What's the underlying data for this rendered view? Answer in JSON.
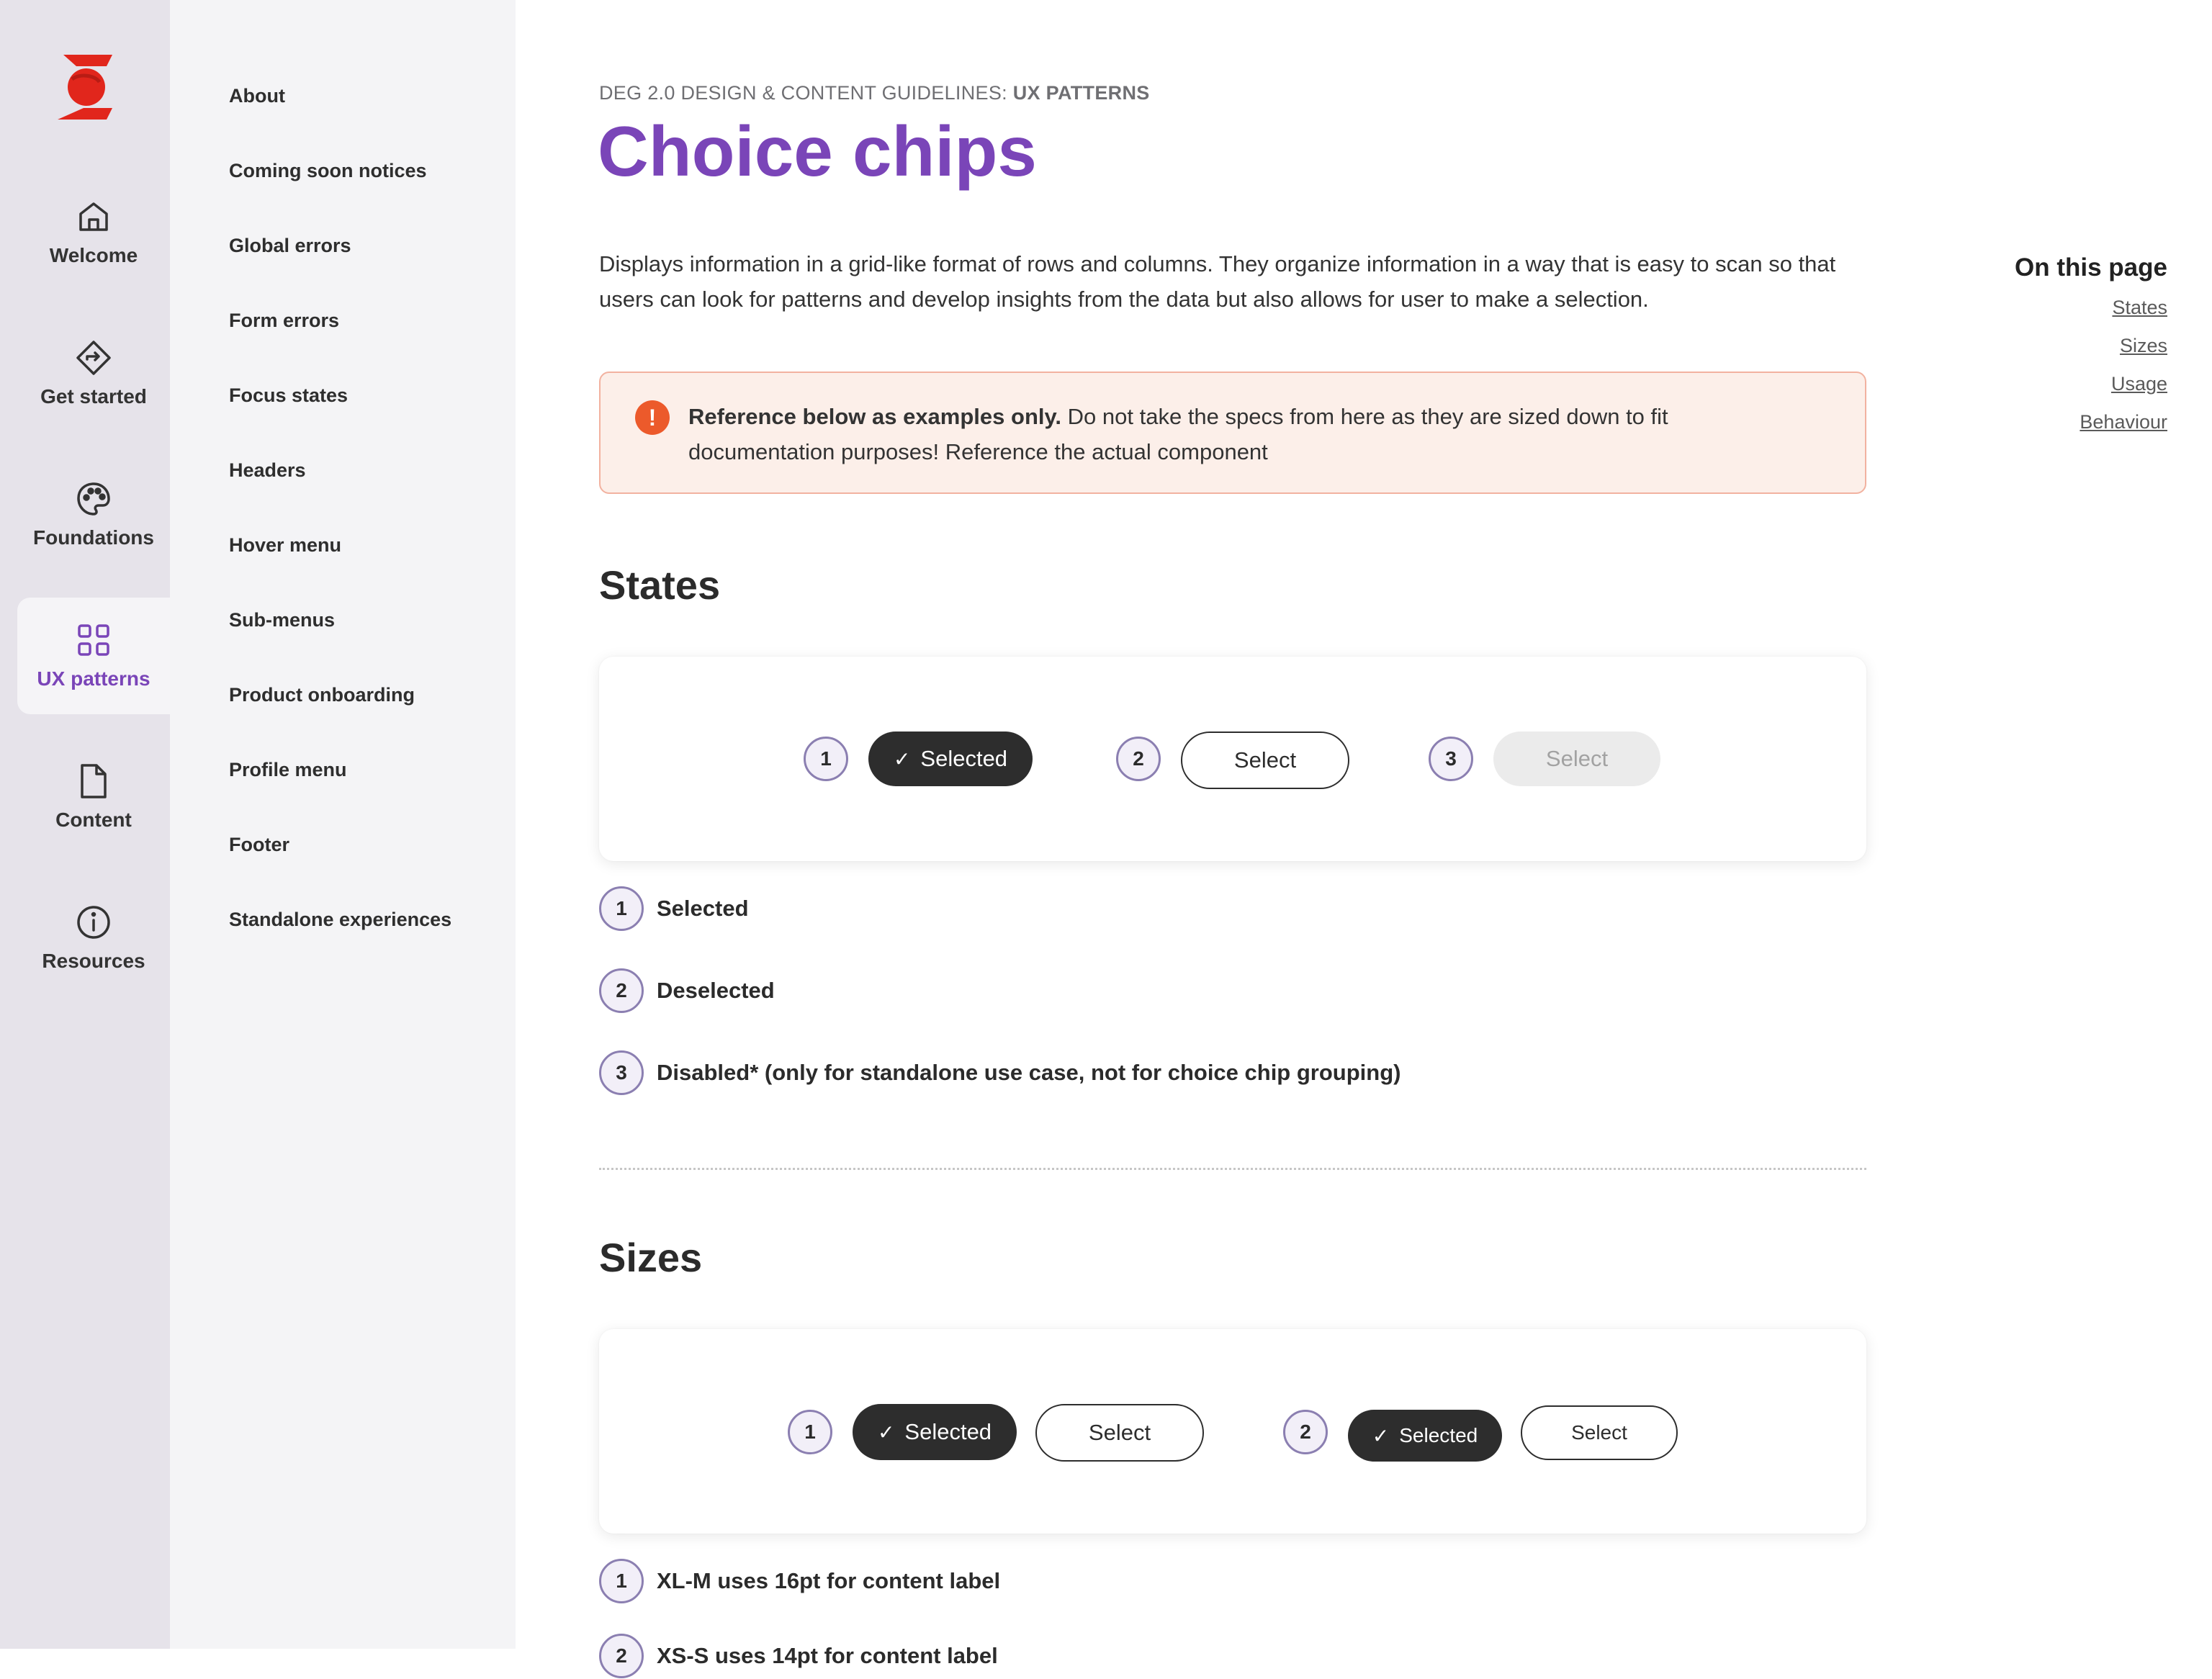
{
  "rail": {
    "items": [
      {
        "label": "Welcome",
        "icon": "home-icon"
      },
      {
        "label": "Get started",
        "icon": "direction-sign-icon"
      },
      {
        "label": "Foundations",
        "icon": "palette-icon"
      },
      {
        "label": "UX patterns",
        "icon": "grid-icon",
        "active": true
      },
      {
        "label": "Content",
        "icon": "document-icon"
      },
      {
        "label": "Resources",
        "icon": "info-icon"
      }
    ]
  },
  "subnav": {
    "items": [
      "About",
      "Coming soon notices",
      "Global errors",
      "Form errors",
      "Focus states",
      "Headers",
      "Hover menu",
      "Sub-menus",
      "Product onboarding",
      "Profile menu",
      "Footer",
      "Standalone experiences"
    ]
  },
  "header": {
    "eyebrow": "DEG 2.0 DESIGN & CONTENT GUIDELINES:",
    "eyebrow_section": "UX PATTERNS",
    "title": "Choice chips"
  },
  "intro": "Displays information in a grid-like format of rows and columns. They organize information in a way that is easy to scan so that users can look for patterns and develop insights from the data but also allows for user to make a selection.",
  "alert": {
    "icon": "exclamation-icon",
    "glyph": "!",
    "bold": "Reference below as examples only.",
    "text": " Do not take the specs from here as they are sized down to fit documentation purposes! Reference the actual component"
  },
  "states": {
    "title": "States",
    "examples": [
      {
        "num": "1",
        "label": "Selected"
      },
      {
        "num": "2",
        "label": "Select"
      },
      {
        "num": "3",
        "label": "Select"
      }
    ],
    "legend": [
      {
        "num": "1",
        "label": "Selected"
      },
      {
        "num": "2",
        "label": "Deselected"
      },
      {
        "num": "3",
        "label": "Disabled* (only for standalone use case, not for choice chip grouping)"
      }
    ]
  },
  "sizes": {
    "title": "Sizes",
    "groups": [
      {
        "num": "1",
        "selected": "Selected",
        "unselected": "Select"
      },
      {
        "num": "2",
        "selected": "Selected",
        "unselected": "Select"
      }
    ],
    "legend": [
      {
        "num": "1",
        "label": "XL-M uses 16pt for content label"
      },
      {
        "num": "2",
        "label": "XS-S uses 14pt for content label"
      }
    ]
  },
  "on_this_page": {
    "title": "On this page",
    "links": [
      "States",
      "Sizes",
      "Usage",
      "Behaviour"
    ]
  },
  "colors": {
    "accent": "#7a45b8",
    "alert_bg": "#fcefe9",
    "alert_border": "#f2b2a0",
    "alert_icon": "#ec5a2b",
    "chip_selected": "#2d2d2d",
    "brand_red": "#e1261c"
  }
}
